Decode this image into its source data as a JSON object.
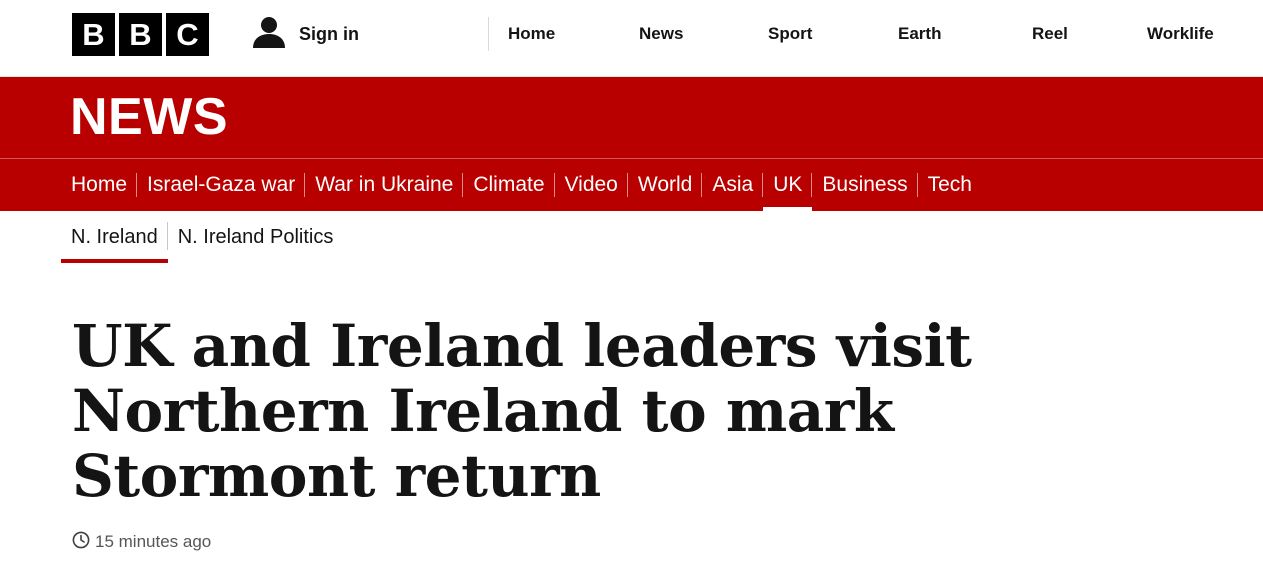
{
  "header": {
    "logo_letters": [
      "B",
      "B",
      "C"
    ],
    "signin_label": "Sign in",
    "signin_icon": "user-icon",
    "nav": [
      {
        "label": "Home"
      },
      {
        "label": "News"
      },
      {
        "label": "Sport"
      },
      {
        "label": "Earth"
      },
      {
        "label": "Reel"
      },
      {
        "label": "Worklife"
      }
    ]
  },
  "section": {
    "wordmark": "NEWS",
    "brand_color": "#b80000",
    "nav": [
      {
        "label": "Home",
        "active": false
      },
      {
        "label": "Israel-Gaza war",
        "active": false
      },
      {
        "label": "War in Ukraine",
        "active": false
      },
      {
        "label": "Climate",
        "active": false
      },
      {
        "label": "Video",
        "active": false
      },
      {
        "label": "World",
        "active": false
      },
      {
        "label": "Asia",
        "active": false
      },
      {
        "label": "UK",
        "active": true
      },
      {
        "label": "Business",
        "active": false
      },
      {
        "label": "Tech",
        "active": false
      }
    ]
  },
  "subnav": [
    {
      "label": "N. Ireland",
      "active": true
    },
    {
      "label": "N. Ireland Politics",
      "active": false
    }
  ],
  "article": {
    "headline": "UK and Ireland leaders visit Northern Ireland to mark Stormont return",
    "timestamp": "15 minutes ago",
    "timestamp_icon": "clock-icon"
  }
}
